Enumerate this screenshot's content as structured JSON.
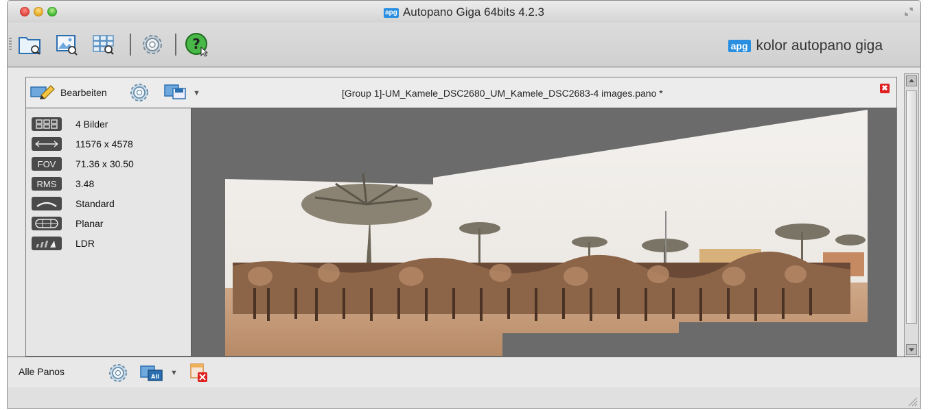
{
  "window": {
    "title": "Autopano Giga 64bits 4.2.3",
    "title_badge": "apg"
  },
  "toolbar": {
    "items": [
      {
        "name": "open-folder-button",
        "icon": "folder-search-icon"
      },
      {
        "name": "open-images-button",
        "icon": "image-search-icon"
      },
      {
        "name": "detect-panoramas-button",
        "icon": "grid-search-icon"
      },
      {
        "name": "settings-button",
        "icon": "gear-icon"
      },
      {
        "name": "help-button",
        "icon": "help-icon"
      }
    ],
    "brand_badge": "apg",
    "brand_text": "kolor autopano giga"
  },
  "panel": {
    "edit_label": "Bearbeiten",
    "title": "[Group 1]-UM_Kamele_DSC2680_UM_Kamele_DSC2683-4 images.pano *",
    "close_glyph": "✖"
  },
  "info": [
    {
      "badge": "888",
      "icon": "image-count-icon",
      "text": "4 Bilder"
    },
    {
      "badge": "⟷",
      "icon": "size-icon",
      "text": "11576 x 4578"
    },
    {
      "badge": "FOV",
      "icon": "fov-icon",
      "text": "71.36 x 30.50"
    },
    {
      "badge": "RMS",
      "icon": "rms-icon",
      "text": "3.48"
    },
    {
      "badge": "",
      "icon": "quality-icon",
      "text": "Standard"
    },
    {
      "badge": "",
      "icon": "projection-icon",
      "text": "Planar"
    },
    {
      "badge": "",
      "icon": "dynamic-range-icon",
      "text": "LDR"
    }
  ],
  "bottom": {
    "label": "Alle Panos",
    "all_badge": "All"
  },
  "colors": {
    "accent": "#2a8fe0",
    "close_red": "#e02020",
    "preview_bg": "#6b6b6b"
  }
}
